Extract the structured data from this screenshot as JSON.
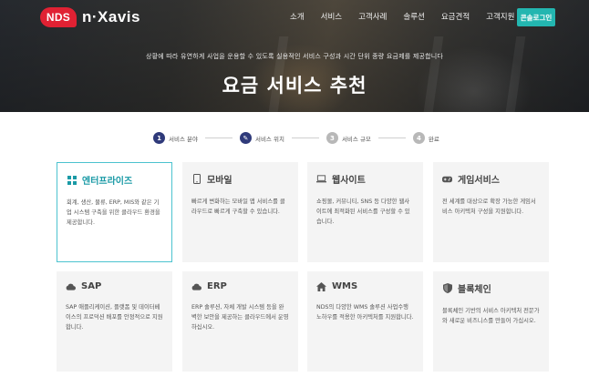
{
  "brand": {
    "badge": "NDS",
    "name": "n·Xavis",
    "color": "#e02133"
  },
  "nav": {
    "items": [
      "소개",
      "서비스",
      "고객사례",
      "솔루션",
      "요금견적",
      "고객지원"
    ],
    "console_label": "콘솔로그인",
    "accent": "#23b6b0"
  },
  "hero": {
    "subtitle": "상황에 따라 유연하게 사업을 운용할 수 있도록 실용적인 서비스 구성과 시간 단위 종량 요금제를 제공합니다",
    "title": "요금 서비스 추천"
  },
  "steps": [
    {
      "num": "1",
      "label": "서비스 분야",
      "state": "active"
    },
    {
      "num": "✎",
      "label": "서비스 위치",
      "state": "current"
    },
    {
      "num": "3",
      "label": "서비스 규모",
      "state": "idle"
    },
    {
      "num": "4",
      "label": "완료",
      "state": "idle"
    }
  ],
  "cards": [
    {
      "title": "엔터프라이즈",
      "icon": "grid-icon",
      "selected": true,
      "desc": "회계, 생산, 물류, ERP, MIS와 같은 기업 시스템 구축을 위한 클라우드 환경을 제공합니다."
    },
    {
      "title": "모바일",
      "icon": "mobile-icon",
      "selected": false,
      "desc": "빠르게 변화하는 모바일 앱 서비스를 클라우드로 빠르게 구축할 수 있습니다."
    },
    {
      "title": "웹사이트",
      "icon": "laptop-icon",
      "selected": false,
      "desc": "쇼핑몰, 커뮤니티, SNS 등 다양한 웹사이트에 최적화된 서비스를 구성할 수 있습니다."
    },
    {
      "title": "게임서비스",
      "icon": "gamepad-icon",
      "selected": false,
      "desc": "전 세계를 대상으로 확장 가능한 게임서비스 아키텍처 구성을 지원합니다."
    },
    {
      "title": "SAP",
      "icon": "cloud-icon",
      "selected": false,
      "desc": "SAP 애플리케이션, 플랫폼 및 데이터베이스의 프로덕션 배포를 안정적으로 지원합니다."
    },
    {
      "title": "ERP",
      "icon": "cloud-icon",
      "selected": false,
      "desc": "ERP 솔루션, 자체 개발 시스템 등을 완벽한 보안을 제공하는 클라우드에서 운영하십시오."
    },
    {
      "title": "WMS",
      "icon": "home-icon",
      "selected": false,
      "desc": "NDS의 다양한 WMS 솔루션 사업수행 노하우를 적용한 아키텍처를 지원합니다."
    },
    {
      "title": "블록체인",
      "icon": "shield-icon",
      "selected": false,
      "desc": "블록체인 기반의 서비스 아키텍처 전문가와 새로운 비즈니스를 만들어 가십시오."
    }
  ]
}
